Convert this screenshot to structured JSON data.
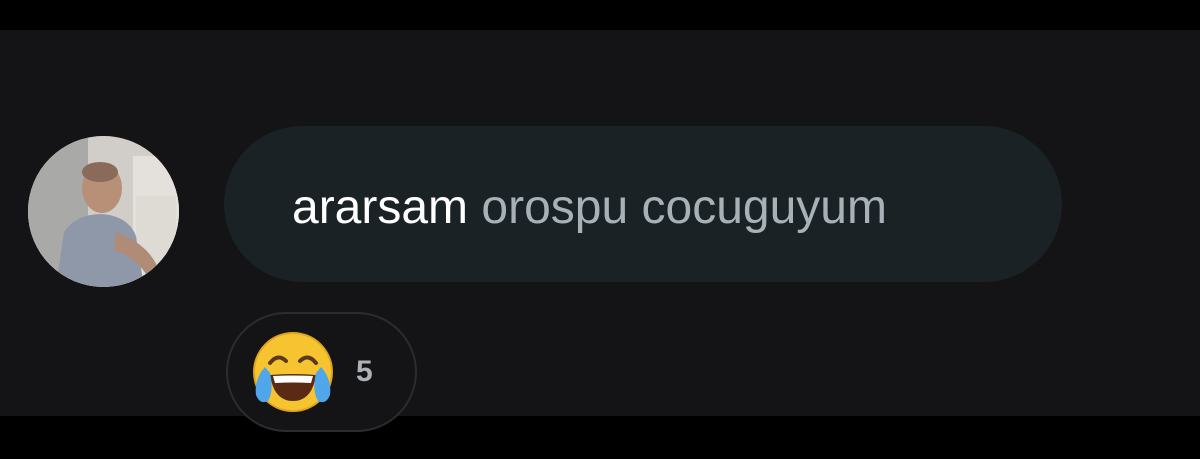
{
  "comment": {
    "text_part1": "ararsam",
    "text_part2": "orospu cocuguyum"
  },
  "reaction": {
    "emoji_icon": "face-with-tears-of-joy-icon",
    "count": "5"
  },
  "colors": {
    "background": "#141416",
    "bubble": "#1b2226",
    "primary_text": "#ffffff",
    "secondary_text": "#a7b2b8"
  }
}
